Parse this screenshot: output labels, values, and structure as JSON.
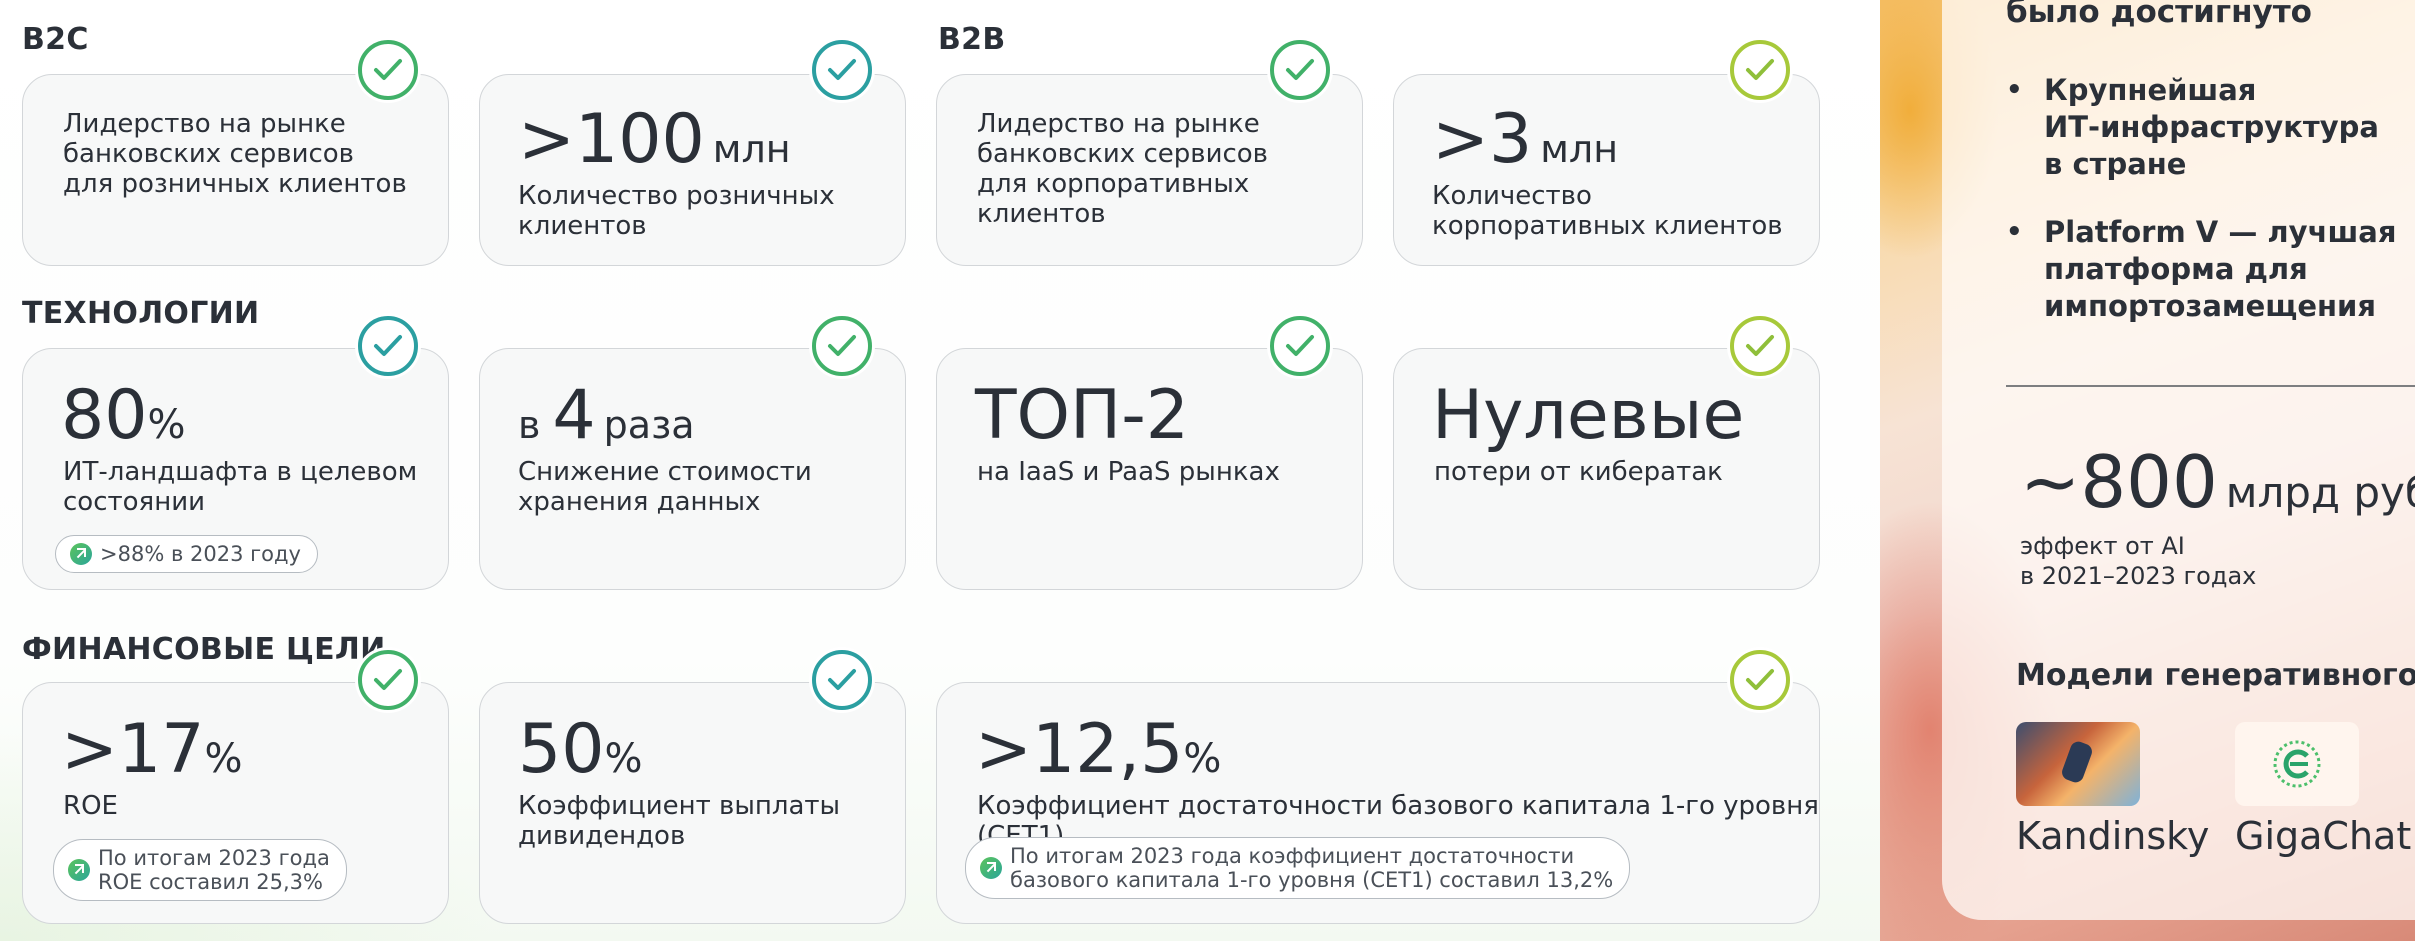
{
  "sections": {
    "b2c": "B2C",
    "b2b": "B2B",
    "tech": "ТЕХНОЛОГИИ",
    "fin": "ФИНАНСОВЫЕ ЦЕЛИ"
  },
  "cards": {
    "b2c_leader": {
      "text": "Лидерство на рынке\nбанковских сервисов\nдля розничных клиентов"
    },
    "b2c_clients": {
      "value": ">100",
      "unit": "млн",
      "text": "Количество розничных\nклиентов"
    },
    "b2b_leader": {
      "text": "Лидерство на рынке\nбанковских сервисов\nдля корпоративных клиентов"
    },
    "b2b_clients": {
      "value": ">3",
      "unit": "млн",
      "text": "Количество\nкорпоративных клиентов"
    },
    "it_landscape": {
      "value": "80",
      "suffix": "%",
      "text": "ИТ-ландшафта в целевом\nсостоянии",
      "pill": ">88% в 2023 году"
    },
    "storage": {
      "prefix": "в",
      "value": "4",
      "unit": "раза",
      "text": "Снижение стоимости\nхранения данных"
    },
    "top2": {
      "value": "ТОП-2",
      "text": "на IaaS и PaaS рынках"
    },
    "zero": {
      "value": "Нулевые",
      "text": "потери от кибератак"
    },
    "roe": {
      "value": ">17",
      "suffix": "%",
      "text": "ROE",
      "pill": "По итогам 2023 года\nROE составил 25,3%"
    },
    "dividends": {
      "value": "50",
      "suffix": "%",
      "text": "Коэффициент выплаты\nдивидендов"
    },
    "cet1": {
      "value": ">12,5",
      "suffix": "%",
      "text": "Коэффициент достаточности базового капитала 1-го уровня (CET1)",
      "pill": "По итогам 2023 года коэффициент достаточности\nбазового капитала 1-го уровня (CET1) составил 13,2%"
    }
  },
  "side": {
    "title": "было достигнуто",
    "bullets": [
      "Крупнейшая\nИТ-инфраструктура\nв стране",
      "Platform V — лучшая\nплатформа для\nимпортозамещения"
    ],
    "ai_value": "~800",
    "ai_unit": "млрд руб.",
    "ai_text": "эффект от AI\nв 2021–2023 годах",
    "models_title": "Модели генеративного ИИ",
    "models": [
      "Kandinsky",
      "GigaChat"
    ]
  },
  "colors": {
    "check_green": "#41b169",
    "check_teal": "#2b9fa1",
    "check_lime": "#a7c93a",
    "text": "#2b3038"
  }
}
